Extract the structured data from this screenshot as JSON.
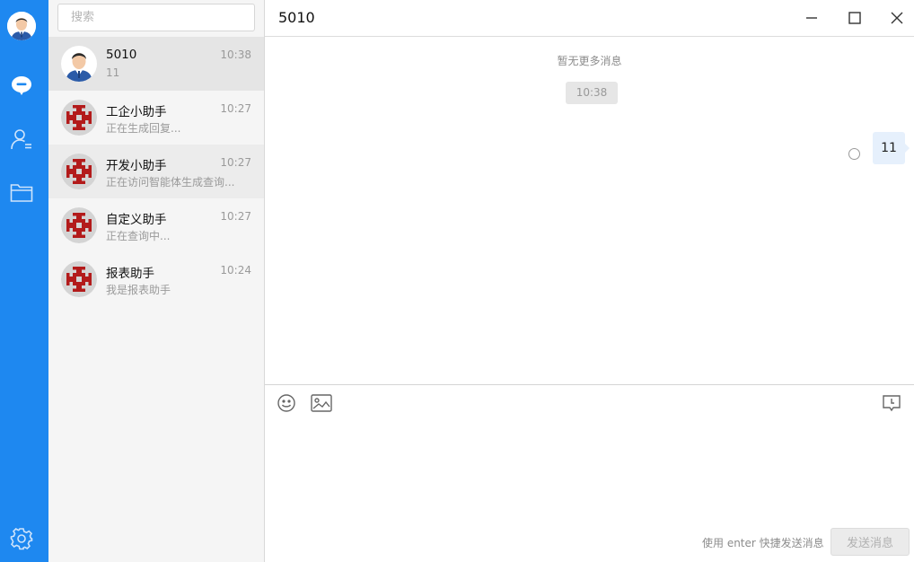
{
  "search": {
    "placeholder": "搜索",
    "value": ""
  },
  "conversations": [
    {
      "name": "5010",
      "time": "10:38",
      "preview": "11",
      "avatar": "user-avatar",
      "active": true
    },
    {
      "name": "工企小助手",
      "time": "10:27",
      "preview": "正在生成回复...",
      "avatar": "bot-avatar"
    },
    {
      "name": "开发小助手",
      "time": "10:27",
      "preview": "正在访问智能体生成查询...",
      "avatar": "bot-avatar"
    },
    {
      "name": "自定义助手",
      "time": "10:27",
      "preview": "正在查询中...",
      "avatar": "bot-avatar"
    },
    {
      "name": "报表助手",
      "time": "10:24",
      "preview": "我是报表助手",
      "avatar": "bot-avatar"
    }
  ],
  "chat": {
    "title": "5010",
    "no_more": "暂无更多消息",
    "timestamp": "10:38",
    "messages": [
      {
        "text": "11",
        "direction": "outgoing"
      }
    ]
  },
  "composer": {
    "hint": "使用 enter 快捷发送消息",
    "send_label": "发送消息"
  },
  "colors": {
    "accent": "#1e88f0",
    "bubble": "#e6f0fc",
    "bot_icon": "#b31b1b"
  },
  "icons": [
    "chat-icon",
    "contacts-icon",
    "folder-icon",
    "settings-icon",
    "emoji-icon",
    "image-icon",
    "feedback-icon",
    "minimize-icon",
    "maximize-icon",
    "close-icon"
  ]
}
